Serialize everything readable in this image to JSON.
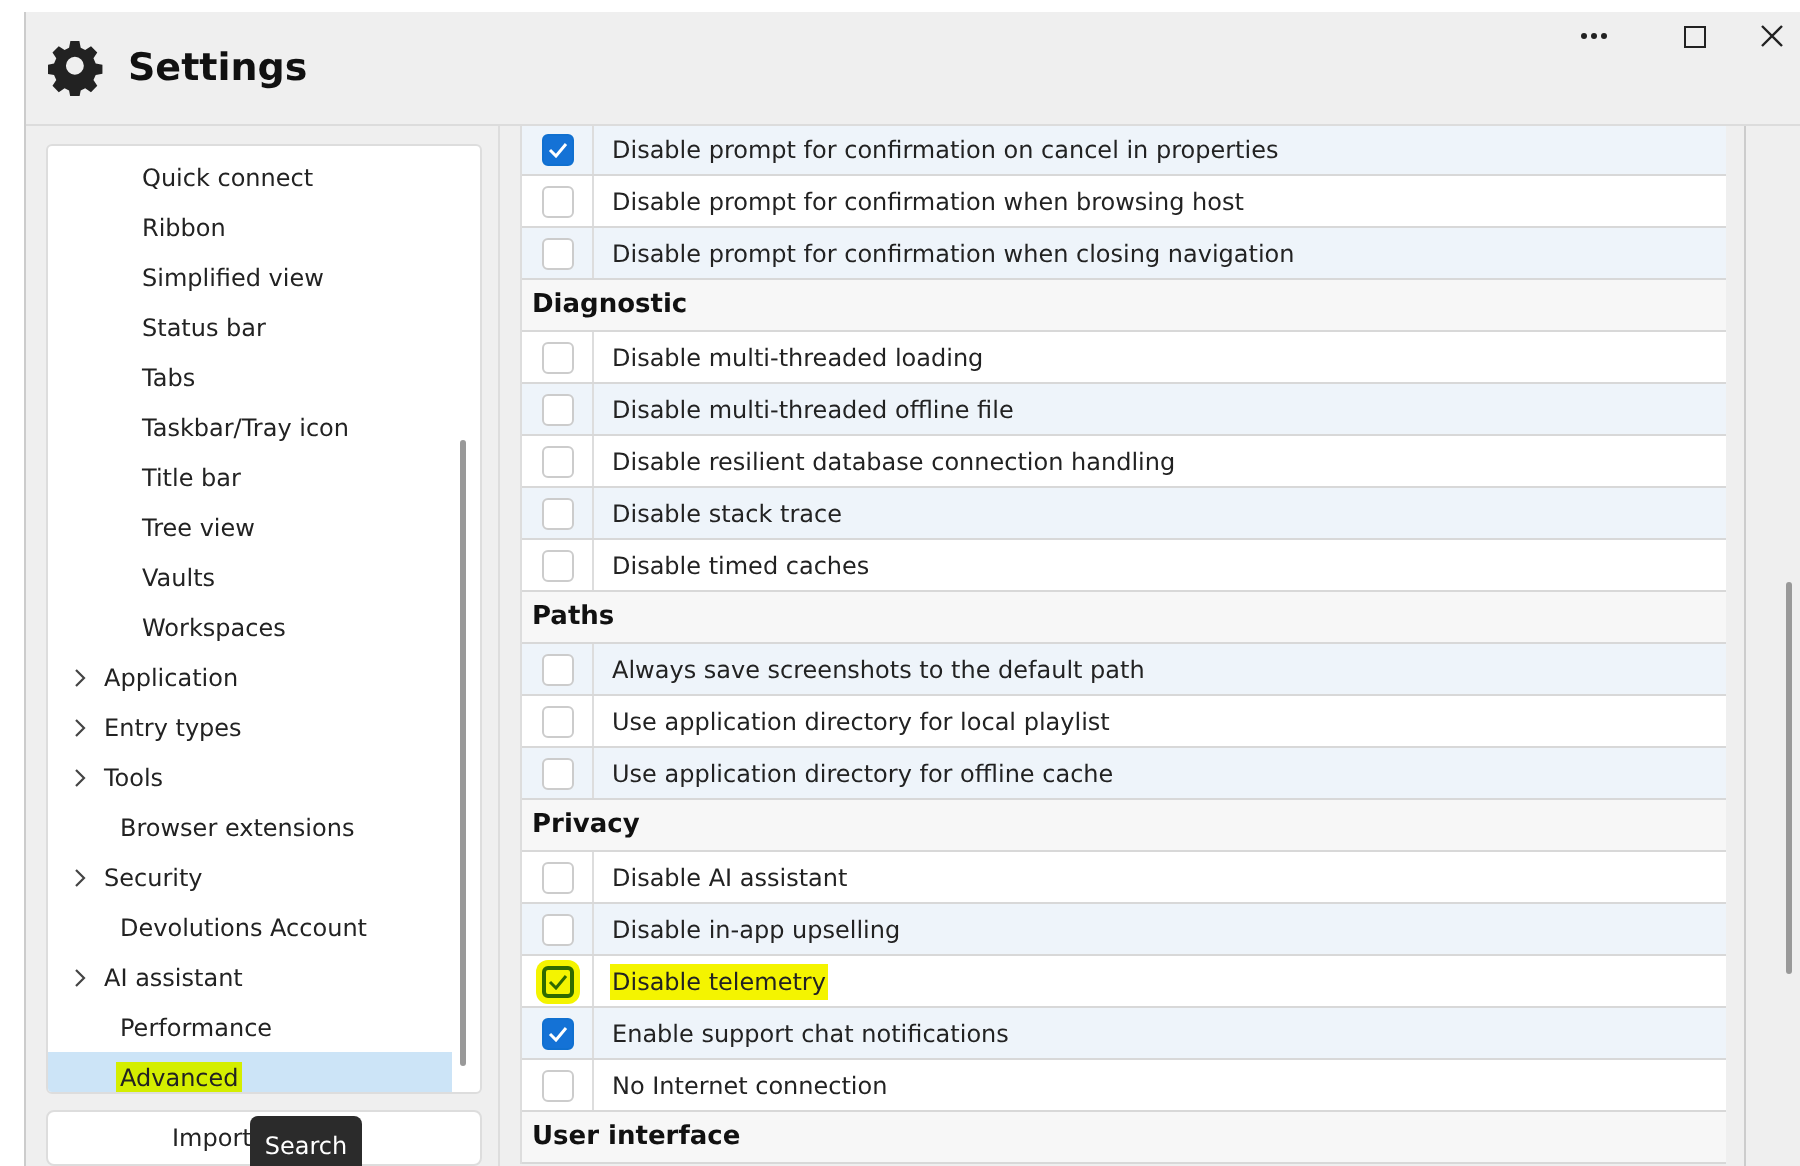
{
  "window": {
    "title": "Settings"
  },
  "sidebar": {
    "sub_items": [
      {
        "label": "Quick connect"
      },
      {
        "label": "Ribbon"
      },
      {
        "label": "Simplified view"
      },
      {
        "label": "Status bar"
      },
      {
        "label": "Tabs"
      },
      {
        "label": "Taskbar/Tray icon"
      },
      {
        "label": "Title bar"
      },
      {
        "label": "Tree view"
      },
      {
        "label": "Vaults"
      },
      {
        "label": "Workspaces"
      }
    ],
    "items": [
      {
        "label": "Application",
        "expandable": true,
        "selected": false,
        "highlighted": false
      },
      {
        "label": "Entry types",
        "expandable": true,
        "selected": false,
        "highlighted": false
      },
      {
        "label": "Tools",
        "expandable": true,
        "selected": false,
        "highlighted": false
      },
      {
        "label": "Browser extensions",
        "expandable": false,
        "selected": false,
        "highlighted": false
      },
      {
        "label": "Security",
        "expandable": true,
        "selected": false,
        "highlighted": false
      },
      {
        "label": "Devolutions Account",
        "expandable": false,
        "selected": false,
        "highlighted": false
      },
      {
        "label": "AI assistant",
        "expandable": true,
        "selected": false,
        "highlighted": false
      },
      {
        "label": "Performance",
        "expandable": false,
        "selected": false,
        "highlighted": false
      },
      {
        "label": "Advanced",
        "expandable": false,
        "selected": true,
        "highlighted": true
      }
    ],
    "import_button": "Import",
    "tooltip": "Search"
  },
  "sections": [
    {
      "options": [
        {
          "label": "Disable prompt for confirmation on cancel in properties",
          "checked": true,
          "highlighted": false
        },
        {
          "label": "Disable prompt for confirmation when browsing host",
          "checked": false,
          "highlighted": false
        },
        {
          "label": "Disable prompt for confirmation when closing navigation",
          "checked": false,
          "highlighted": false
        }
      ]
    },
    {
      "title": "Diagnostic",
      "options": [
        {
          "label": "Disable multi-threaded loading",
          "checked": false,
          "highlighted": false
        },
        {
          "label": "Disable multi-threaded offline file",
          "checked": false,
          "highlighted": false
        },
        {
          "label": "Disable resilient database connection handling",
          "checked": false,
          "highlighted": false
        },
        {
          "label": "Disable stack trace",
          "checked": false,
          "highlighted": false
        },
        {
          "label": "Disable timed caches",
          "checked": false,
          "highlighted": false
        }
      ]
    },
    {
      "title": "Paths",
      "options": [
        {
          "label": "Always save screenshots to the default path",
          "checked": false,
          "highlighted": false
        },
        {
          "label": "Use application directory for local playlist",
          "checked": false,
          "highlighted": false
        },
        {
          "label": "Use application directory for offline cache",
          "checked": false,
          "highlighted": false
        }
      ]
    },
    {
      "title": "Privacy",
      "options": [
        {
          "label": "Disable AI assistant",
          "checked": false,
          "highlighted": false
        },
        {
          "label": "Disable in-app upselling",
          "checked": false,
          "highlighted": false
        },
        {
          "label": "Disable telemetry",
          "checked": true,
          "highlighted": true
        },
        {
          "label": "Enable support chat notifications",
          "checked": true,
          "highlighted": false
        },
        {
          "label": "No Internet connection",
          "checked": false,
          "highlighted": false
        }
      ]
    },
    {
      "title": "User interface"
    }
  ]
}
